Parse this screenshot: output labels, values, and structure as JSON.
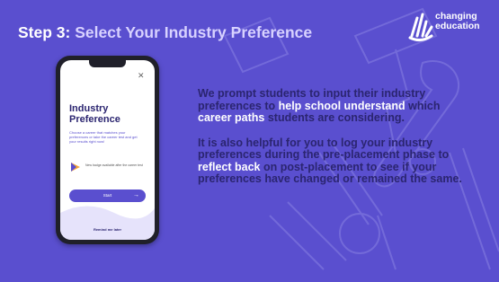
{
  "slide": {
    "title_prefix": "Step 3: ",
    "title_highlight": "Select Your Industry Preference",
    "background_color": "#5a4fcf",
    "logo": {
      "line1": "changing",
      "line2": "education",
      "icon": "hand-logo-icon"
    }
  },
  "body": {
    "p1_a": "We prompt students to input their industry preferences to ",
    "p1_b": "help school understand",
    "p1_c": " which ",
    "p1_d": "career paths",
    "p1_e": " students are considering.",
    "p2_a": "It is also helpful for you to log your industry preferences during the pre-placement phase to ",
    "p2_b": "reflect back",
    "p2_c": " on post-placement to see if your preferences have changed or remained the same."
  },
  "phone": {
    "close_icon": "close-icon",
    "title_line1": "Industry",
    "title_line2": "Preference",
    "description": "Choose a career that matches your preferences or take the career test and get your results right now!",
    "hint_text": "New badge available after the career test",
    "start_label": "Start",
    "start_arrow": "→",
    "remind_label": "Remind me later"
  }
}
